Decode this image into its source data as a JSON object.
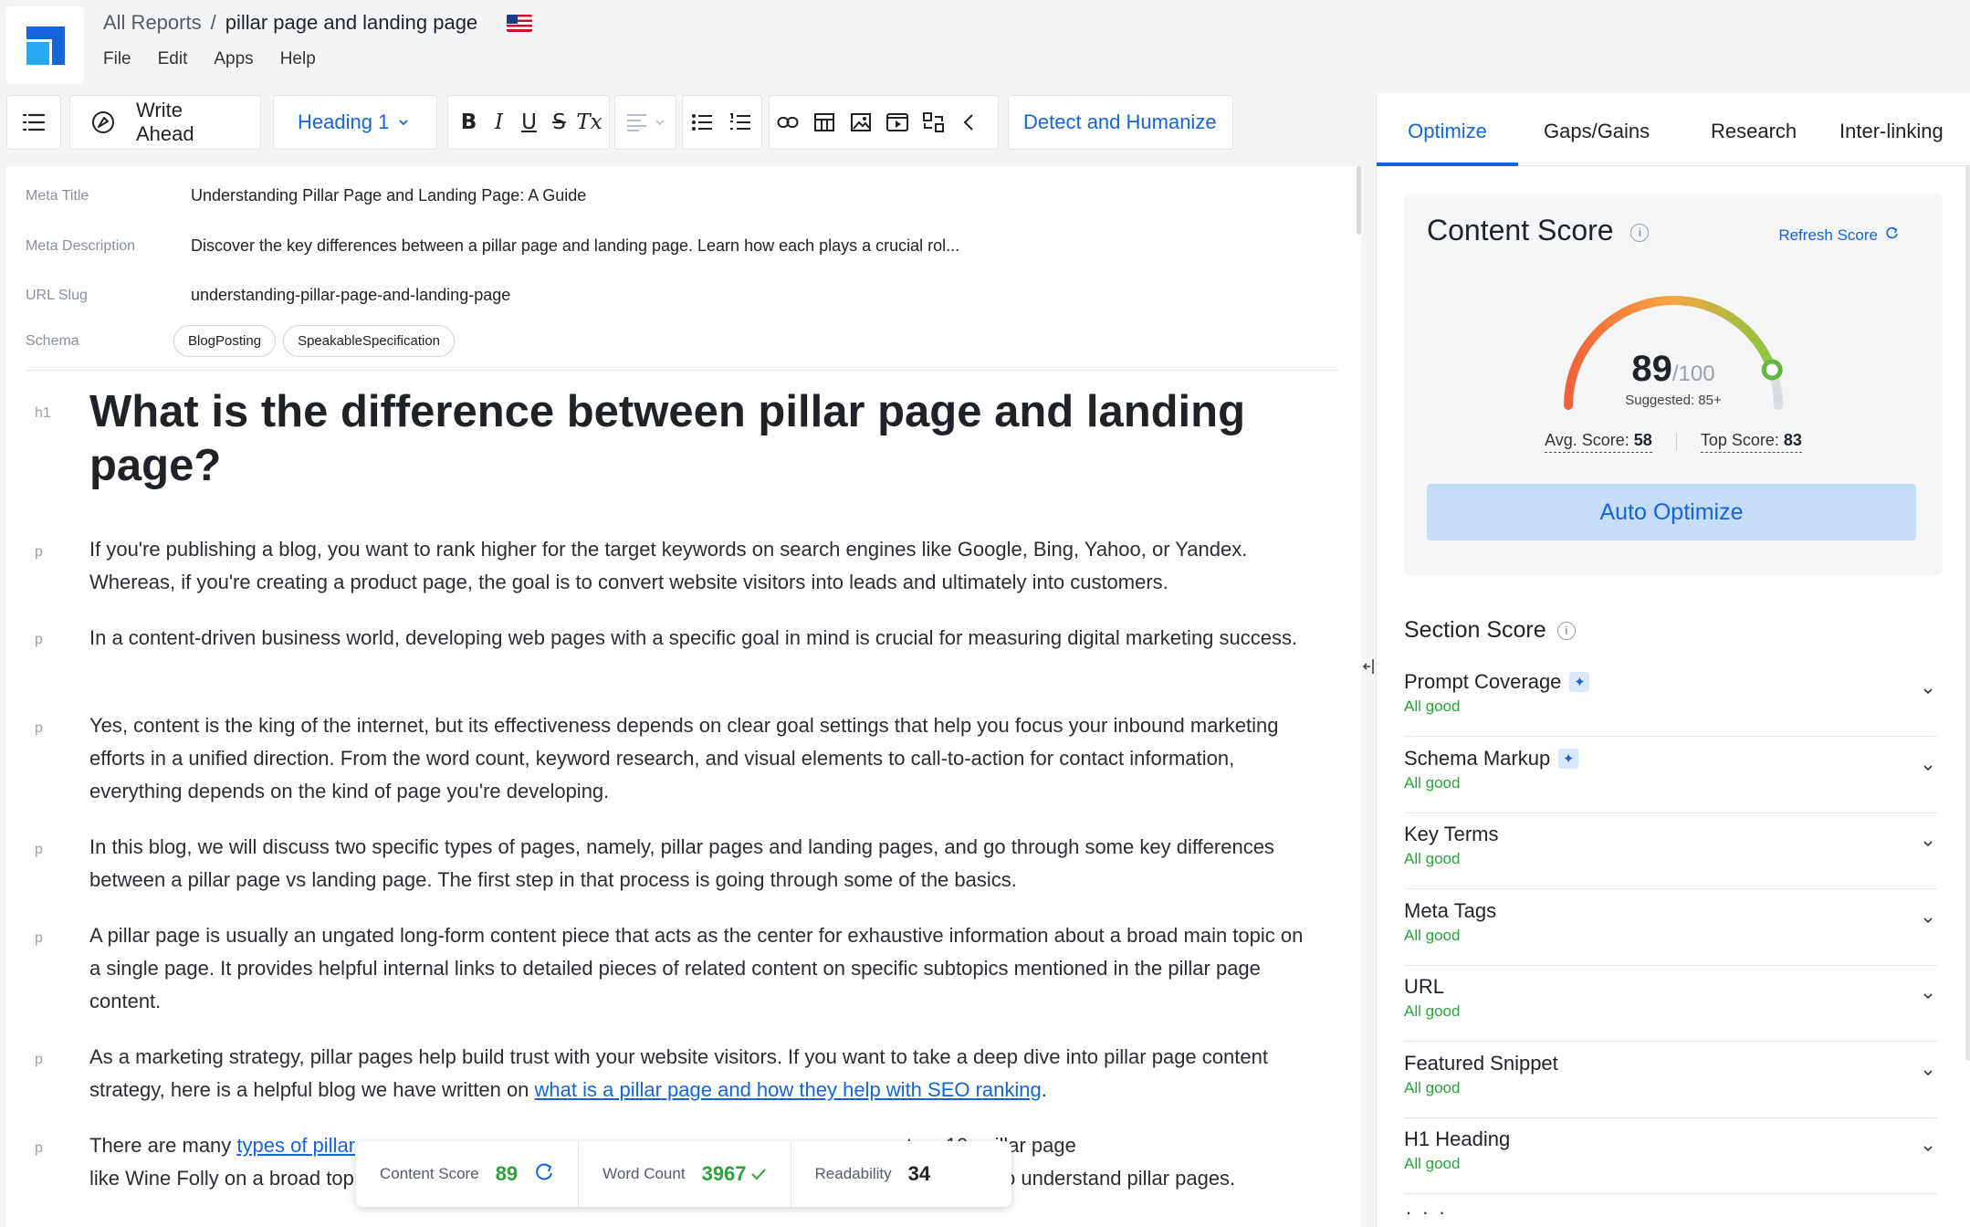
{
  "header": {
    "breadcrumb_root": "All Reports",
    "breadcrumb_sep": "/",
    "breadcrumb_current": "pillar page and landing page",
    "flag_icon": "us-flag-icon"
  },
  "menu": [
    "File",
    "Edit",
    "Apps",
    "Help"
  ],
  "toolbar": {
    "write_ahead": "Write Ahead",
    "heading_select": "Heading 1",
    "bold": "B",
    "italic": "I",
    "underline": "U",
    "strike": "S",
    "clear": "Tx",
    "detect_humanize": "Detect and Humanize"
  },
  "meta": {
    "title_label": "Meta Title",
    "title_value": "Understanding Pillar Page and Landing Page: A Guide",
    "description_label": "Meta Description",
    "description_value": "Discover the key differences between a pillar page and landing page. Learn how each plays a crucial rol...",
    "slug_label": "URL Slug",
    "slug_value": "understanding-pillar-page-and-landing-page",
    "schema_label": "Schema",
    "schema_chips": [
      "BlogPosting",
      "SpeakableSpecification"
    ]
  },
  "document": {
    "h1_tag": "h1",
    "p_tag": "p",
    "h1": "What is the difference between pillar page and landing page?",
    "paragraphs": [
      "If you're publishing a blog, you want to rank higher for the target keywords on search engines like Google, Bing, Yahoo, or Yandex. Whereas, if you're creating a product page, the goal is to convert website visitors into leads and ultimately into customers.",
      "In a content-driven business world, developing web pages with a specific goal in mind is crucial for measuring digital marketing success.",
      "Yes, content is the king of the internet, but its effectiveness depends on clear goal settings that help you focus your inbound marketing efforts in a unified direction. From the word count, keyword research, and visual elements to call-to-action for contact information, everything depends on the kind of page you're developing.",
      "In this blog, we will discuss two specific types of pages, namely, pillar pages and landing pages, and go through some key differences between a pillar page vs landing page. The first step in that process is going through some of the basics.",
      "A pillar page is usually an ungated long-form content piece that acts as the center for exhaustive information about a broad main topic on a single page. It provides helpful internal links to detailed pieces of related content on specific subtopics mentioned in the pillar page content."
    ],
    "p6_before": "As a marketing strategy, pillar pages help build trust with your website visitors. If you want to take a deep dive into pillar page content strategy, here is a helpful blog we have written on ",
    "p6_link": "what is a pillar page and how they help with SEO ranking",
    "p6_after": ".",
    "p7_before": "There are many ",
    "p7_link": "types of pillar",
    "p7_mid": "                                                                                  u can create a 10x pillar page",
    "p7_line2_start": "like Wine Folly on a broad top",
    "p7_line2_end": "o understand pillar pages."
  },
  "stats": {
    "content_score_label": "Content Score",
    "content_score": "89",
    "word_count_label": "Word Count",
    "word_count": "3967",
    "readability_label": "Readability",
    "readability": "34"
  },
  "panel": {
    "tabs": [
      "Optimize",
      "Gaps/Gains",
      "Research",
      "Inter-linking"
    ],
    "active_tab": "Optimize",
    "content_score_title": "Content Score",
    "refresh_label": "Refresh Score",
    "score": "89",
    "score_denominator": "/100",
    "suggested": "Suggested: 85+",
    "avg_label": "Avg. Score:",
    "avg_value": "58",
    "top_label": "Top Score:",
    "top_value": "83",
    "auto_optimize": "Auto Optimize",
    "section_score_title": "Section Score",
    "sections": [
      {
        "name": "Prompt Coverage",
        "status": "All good",
        "ai": true
      },
      {
        "name": "Schema Markup",
        "status": "All good",
        "ai": true
      },
      {
        "name": "Key Terms",
        "status": "All good",
        "ai": false
      },
      {
        "name": "Meta Tags",
        "status": "All good",
        "ai": false
      },
      {
        "name": "URL",
        "status": "All good",
        "ai": false
      },
      {
        "name": "Featured Snippet",
        "status": "All good",
        "ai": false
      },
      {
        "name": "H1 Heading",
        "status": "All good",
        "ai": false
      }
    ],
    "more_indicator": ". . ."
  },
  "colors": {
    "accent": "#1565d8",
    "good": "#2aa33a",
    "gauge_start": "#f2623a",
    "gauge_end": "#8cc63f"
  },
  "gauge": {
    "value": 89,
    "max": 100
  }
}
